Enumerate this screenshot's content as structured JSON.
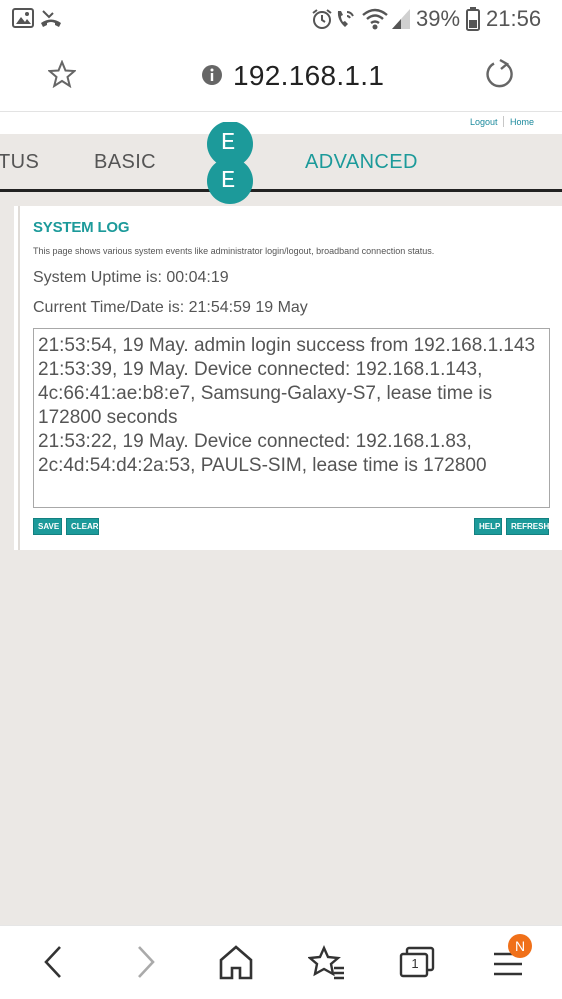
{
  "status_bar": {
    "battery_percent": "39%",
    "time": "21:56",
    "icons": [
      "gallery-icon",
      "missed-call-icon",
      "alarm-icon",
      "wifi-call-icon",
      "wifi-icon",
      "signal-icon",
      "battery-icon"
    ]
  },
  "browser": {
    "url": "192.168.1.1",
    "icons": [
      "bookmark-star-icon",
      "info-icon",
      "reload-icon"
    ]
  },
  "top_links": {
    "logout": "Logout",
    "home": "Home"
  },
  "nav": {
    "status": "TUS",
    "basic": "BASIC",
    "advanced": "ADVANCED",
    "logo_letters": [
      "E",
      "E"
    ]
  },
  "system_log": {
    "title": "SYSTEM LOG",
    "description": "This page shows various system events like administrator login/logout, broadband connection status.",
    "uptime": "System Uptime is: 00:04:19",
    "current_time": "Current Time/Date is: 21:54:59 19 May",
    "entries": [
      "21:53:54, 19 May. admin login success from 192.168.1.143",
      "21:53:39, 19 May. Device connected: 192.168.1.143, 4c:66:41:ae:b8:e7, Samsung-Galaxy-S7, lease time is 172800 seconds",
      "21:53:22, 19 May. Device connected: 192.168.1.83, 2c:4d:54:d4:2a:53, PAULS-SIM, lease time is 172800"
    ],
    "buttons": {
      "save": "SAVE",
      "clear": "CLEAR",
      "help": "HELP",
      "refresh": "REFRESH"
    }
  },
  "bottom_nav": {
    "tab_count": "1",
    "notification_badge": "N",
    "icons": [
      "back-icon",
      "forward-icon",
      "home-icon",
      "bookmarks-icon",
      "tabs-icon",
      "menu-icon"
    ]
  },
  "colors": {
    "accent": "#1c9a9a",
    "page_bg": "#ebe8e5",
    "badge": "#f07019"
  }
}
